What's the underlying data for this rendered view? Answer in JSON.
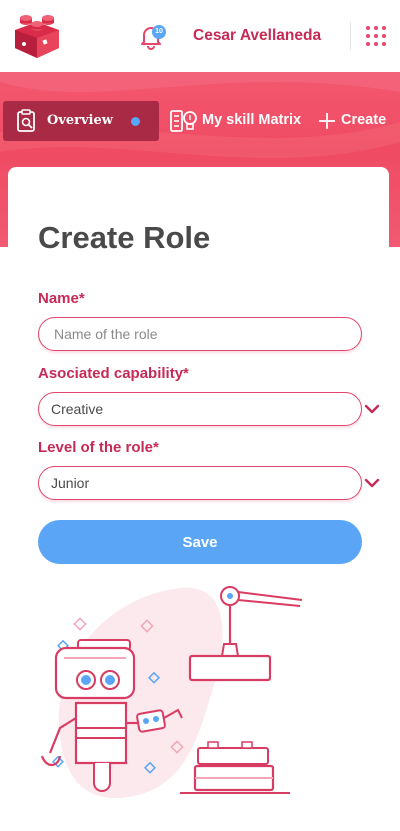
{
  "header": {
    "user_name": "Cesar Avellaneda",
    "notification_count": "10"
  },
  "tabs": {
    "overview_label": "Overview",
    "skill_matrix_label": "My skill Matrix",
    "create_label": "Create"
  },
  "form": {
    "title": "Create Role",
    "name_label": "Name*",
    "name_placeholder": "Name of the role",
    "name_value": "",
    "capability_label": "Asociated capability*",
    "capability_value": "Creative",
    "level_label": "Level of the role*",
    "level_value": "Junior",
    "save_label": "Save"
  },
  "colors": {
    "brand": "#e8456a",
    "accent_blue": "#5aa5f5",
    "label_pink": "#c62a56",
    "active_tab": "#a82a45"
  }
}
